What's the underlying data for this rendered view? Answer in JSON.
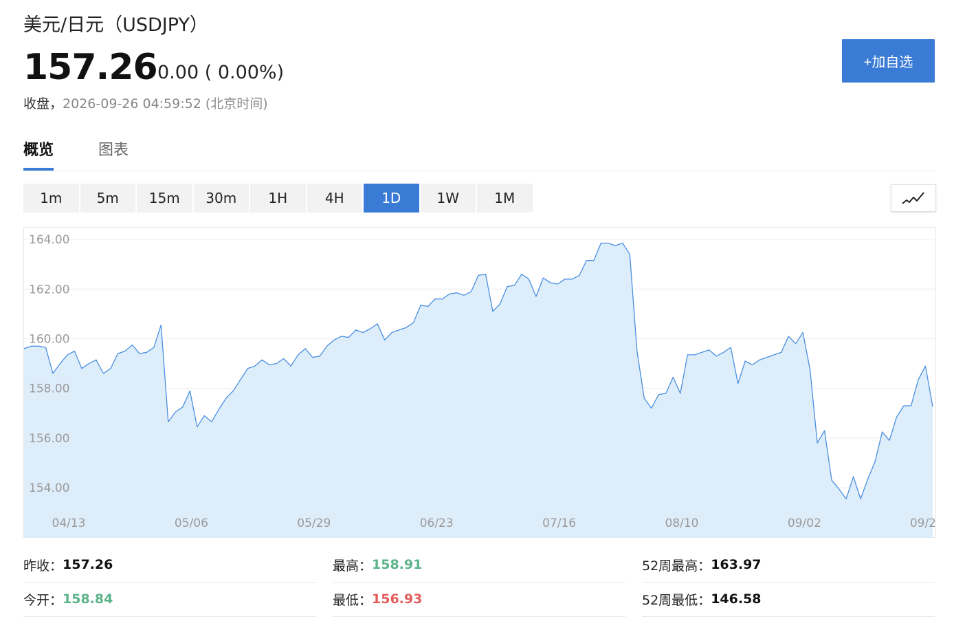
{
  "header": {
    "title": "美元/日元（USDJPY）",
    "price": "157.26",
    "change": "0.00 ( 0.00%)",
    "status_label": "收盘，",
    "timestamp": "2026-09-26 04:59:52 (北京时间)",
    "add_button": "+加自选"
  },
  "tabs": [
    {
      "label": "概览",
      "active": true
    },
    {
      "label": "图表",
      "active": false
    }
  ],
  "periods": [
    {
      "label": "1m",
      "active": false
    },
    {
      "label": "5m",
      "active": false
    },
    {
      "label": "15m",
      "active": false
    },
    {
      "label": "30m",
      "active": false
    },
    {
      "label": "1H",
      "active": false
    },
    {
      "label": "4H",
      "active": false
    },
    {
      "label": "1D",
      "active": true
    },
    {
      "label": "1W",
      "active": false
    },
    {
      "label": "1M",
      "active": false
    }
  ],
  "chart_type_icon": "line-chart-icon",
  "colors": {
    "accent": "#3a7bd5",
    "line": "#4a8fe0",
    "fill": "#deedfa",
    "up": "#5bb38a",
    "down": "#e35d5d"
  },
  "chart_data": {
    "type": "area",
    "ylim": [
      153.2,
      164.5
    ],
    "yticks": [
      154,
      156,
      158,
      160,
      162,
      164
    ],
    "ytick_labels": [
      "154.00",
      "156.00",
      "158.00",
      "160.00",
      "162.00",
      "164.00"
    ],
    "xtick_labels": [
      "04/13",
      "05/06",
      "05/29",
      "06/23",
      "07/16",
      "08/10",
      "09/02",
      "09/2"
    ],
    "grid": true,
    "values": [
      159.6,
      159.7,
      159.7,
      159.65,
      158.6,
      159.0,
      159.35,
      159.5,
      158.8,
      159.0,
      159.15,
      158.6,
      158.8,
      159.4,
      159.5,
      159.75,
      159.4,
      159.45,
      159.65,
      160.55,
      156.65,
      157.05,
      157.25,
      157.9,
      156.45,
      156.9,
      156.65,
      157.15,
      157.6,
      157.9,
      158.35,
      158.8,
      158.9,
      159.15,
      158.95,
      159.0,
      159.2,
      158.9,
      159.35,
      159.6,
      159.25,
      159.3,
      159.7,
      159.95,
      160.1,
      160.05,
      160.35,
      160.25,
      160.4,
      160.6,
      159.95,
      160.25,
      160.35,
      160.45,
      160.65,
      161.35,
      161.3,
      161.6,
      161.6,
      161.8,
      161.85,
      161.75,
      161.9,
      162.55,
      162.6,
      161.1,
      161.4,
      162.1,
      162.15,
      162.6,
      162.4,
      161.7,
      162.45,
      162.25,
      162.2,
      162.4,
      162.4,
      162.55,
      163.15,
      163.15,
      163.85,
      163.85,
      163.75,
      163.85,
      163.4,
      159.5,
      157.6,
      157.2,
      157.75,
      157.8,
      158.45,
      157.8,
      159.35,
      159.35,
      159.45,
      159.55,
      159.3,
      159.45,
      159.65,
      158.2,
      159.1,
      158.95,
      159.15,
      159.25,
      159.35,
      159.45,
      160.1,
      159.8,
      160.25,
      158.75,
      155.8,
      156.3,
      154.3,
      153.95,
      153.55,
      154.45,
      153.55,
      154.35,
      155.05,
      156.25,
      155.9,
      156.85,
      157.3,
      157.3,
      158.35,
      158.9,
      157.26
    ]
  },
  "stats": [
    {
      "label": "昨收：",
      "value": "157.26",
      "tone": "neutral"
    },
    {
      "label": "最高：",
      "value": "158.91",
      "tone": "up"
    },
    {
      "label": "52周最高：",
      "value": "163.97",
      "tone": "neutral"
    },
    {
      "label": "今开：",
      "value": "158.84",
      "tone": "up"
    },
    {
      "label": "最低：",
      "value": "156.93",
      "tone": "down"
    },
    {
      "label": "52周最低：",
      "value": "146.58",
      "tone": "neutral"
    }
  ]
}
